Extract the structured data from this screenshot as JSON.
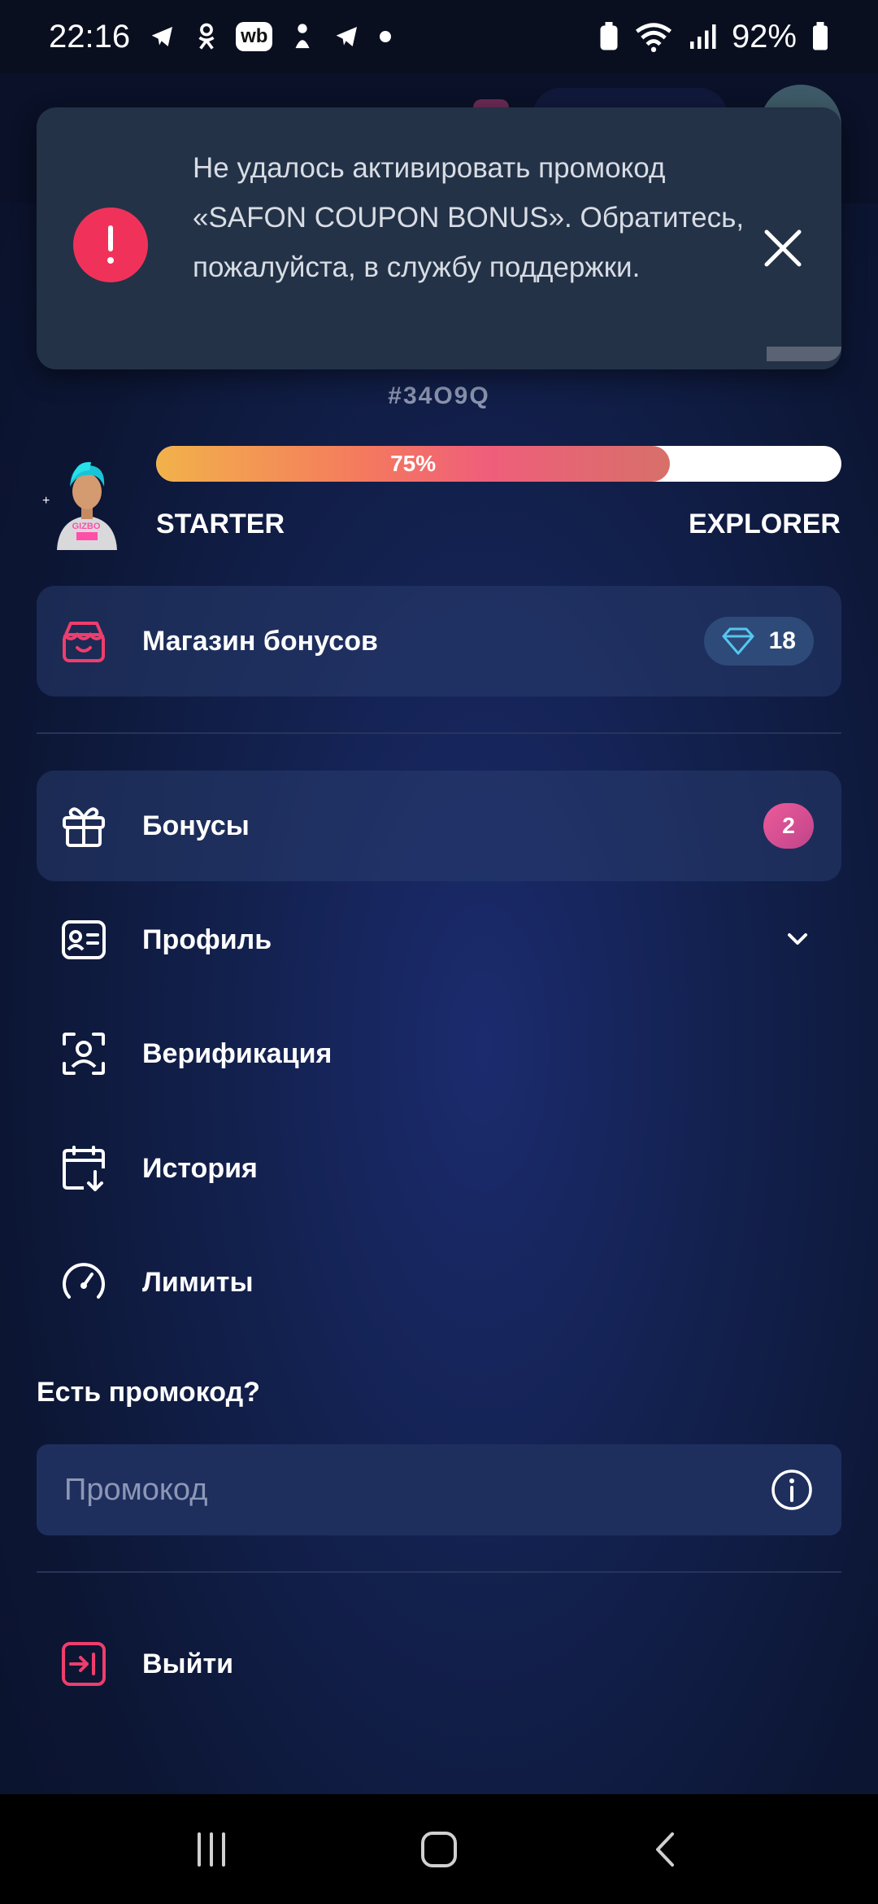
{
  "status_bar": {
    "time": "22:16",
    "wb_label": "wb",
    "battery": "92%",
    "notification_icons": [
      "telegram-icon",
      "odnoklassniki-icon",
      "wb-icon",
      "app-icon",
      "telegram-icon",
      "dot-icon"
    ]
  },
  "toast": {
    "message": "Не удалось активировать промокод «SAFON COUPON BONUS». Обратитесь, пожалуйста, в службу поддержки.",
    "alert_glyph": "!"
  },
  "profile": {
    "user_id": "#34O9Q",
    "avatar_badge": "GIZBO"
  },
  "level": {
    "progress_label": "75%",
    "progress_fraction": 0.75,
    "current": "STARTER",
    "next": "EXPLORER"
  },
  "shop": {
    "label": "Магазин бонусов",
    "gems": "18"
  },
  "menu": {
    "bonuses": {
      "label": "Бонусы",
      "count": "2"
    },
    "profile": {
      "label": "Профиль"
    },
    "verification": {
      "label": "Верификация"
    },
    "history": {
      "label": "История"
    },
    "limits": {
      "label": "Лимиты"
    }
  },
  "promo": {
    "title": "Есть промокод?",
    "placeholder": "Промокод"
  },
  "logout": {
    "label": "Выйти"
  },
  "colors": {
    "accent_pink": "#ef3d6d",
    "alert_red": "#f0325a",
    "background": "#13214f",
    "card": "#1e2f5e"
  }
}
